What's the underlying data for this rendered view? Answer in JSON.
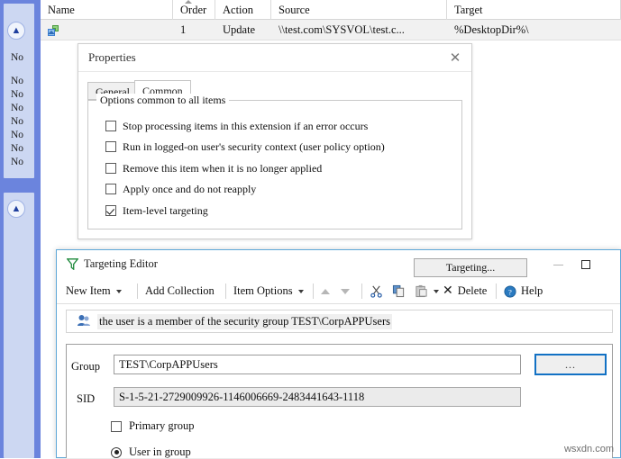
{
  "sidebar": {
    "chevron_icon": "chevron-double-up-icon",
    "entries": [
      "No",
      "No",
      "No",
      "No",
      "No",
      "No",
      "No",
      "No"
    ]
  },
  "list": {
    "columns": [
      "Name",
      "Order",
      "Action",
      "Source",
      "Target"
    ],
    "sort_indicator": "sort-ascending-arrow",
    "rows": [
      {
        "icon": "shortcut-item-icon",
        "name": "",
        "order": "1",
        "action": "Update",
        "source": "\\\\test.com\\SYSVOL\\test.c...",
        "target": "%DesktopDir%\\"
      }
    ]
  },
  "properties_dialog": {
    "title": "Properties",
    "close_icon": "close-icon",
    "tabs": [
      {
        "label": "General",
        "selected": false
      },
      {
        "label": "Common",
        "selected": true
      }
    ],
    "groupbox_legend": "Options common to all items",
    "options": [
      {
        "label": "Stop processing items in this extension if an error occurs",
        "checked": false
      },
      {
        "label": "Run in logged-on user's security context (user policy option)",
        "checked": false
      },
      {
        "label": "Remove this item when it is no longer applied",
        "checked": false
      },
      {
        "label": "Apply once and do not reapply",
        "checked": false
      },
      {
        "label": "Item-level targeting",
        "checked": true
      }
    ],
    "targeting_button": "Targeting..."
  },
  "targeting_editor": {
    "title": "Targeting Editor",
    "title_icon": "filter-funnel-icon",
    "minimize_icon": "minimize-icon",
    "maximize_icon": "maximize-icon",
    "toolbar": {
      "new_item": "New Item",
      "add_collection": "Add Collection",
      "item_options": "Item Options",
      "move_up_icon": "arrow-up-icon",
      "move_down_icon": "arrow-down-icon",
      "cut_icon": "scissors-cut-icon",
      "copy_icon": "copy-icon",
      "paste_icon": "paste-icon",
      "delete": "Delete",
      "delete_icon": "x-delete-icon",
      "help": "Help",
      "help_icon": "help-circle-icon"
    },
    "item": {
      "icon": "security-group-icon",
      "text": "the user is a member of the security group TEST\\CorpAPPUsers"
    },
    "details": {
      "group_label": "Group",
      "group_value": "TEST\\CorpAPPUsers",
      "browse_button": "...",
      "sid_label": "SID",
      "sid_value": "S-1-5-21-2729009926-1146006669-2483441643-1118",
      "primary_group_label": "Primary group",
      "primary_group_checked": false,
      "user_in_group_label": "User in group",
      "user_in_group_selected": true
    }
  },
  "watermark": "wsxdn.com",
  "colors": {
    "rail_blue": "#6b84dd",
    "rail_panel": "#ccd7f2",
    "window_border_accent": "#5fa8d8",
    "focus_border": "#1271c4",
    "row_highlight": "#f1f1f1"
  }
}
